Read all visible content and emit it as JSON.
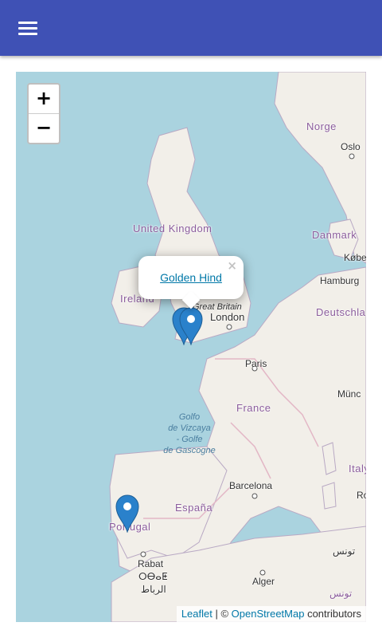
{
  "appbar": {
    "color": "#3f51b5",
    "menu_icon": "hamburger-menu-icon"
  },
  "map": {
    "zoom_in_label": "+",
    "zoom_out_label": "−",
    "labels": {
      "norge": "Norge",
      "oslo": "Oslo",
      "uk": "United Kingdom",
      "danmark": "Danmark",
      "kobenhavn": "Købe",
      "hamburg": "Hamburg",
      "ireland": "Ireland",
      "great_britain": "Great Britain",
      "london": "London",
      "deutschland": "Deutschla",
      "paris": "Paris",
      "munchen": "Münc",
      "france": "France",
      "golfo1": "Golfo",
      "golfo2": "de Vizcaya",
      "golfo3": "- Golfe",
      "golfo4": "de Gascogne",
      "italia": "Italy",
      "rome": "Ro",
      "barcelona": "Barcelona",
      "espana": "España",
      "portugal": "Portugal",
      "tunis": "تونس",
      "alger": "Alger",
      "tunisia": "تونس",
      "rabat": "Rabat",
      "rabat_tifinagh": "ⵔⴱⴰⵟ",
      "rabat_arabic": "الرباط"
    },
    "popup": {
      "link_text": "Golden Hind",
      "close_label": "×"
    },
    "markers": [
      "marker-cornwall-a",
      "marker-cornwall-b",
      "marker-portugal"
    ],
    "attribution": {
      "leaflet": "Leaflet",
      "sep": " | © ",
      "osm": "OpenStreetMap",
      "suffix": " contributors"
    },
    "colors": {
      "water": "#aad3df",
      "land": "#f2efe9",
      "marker": "#2a81cb",
      "link": "#0078a8"
    }
  }
}
